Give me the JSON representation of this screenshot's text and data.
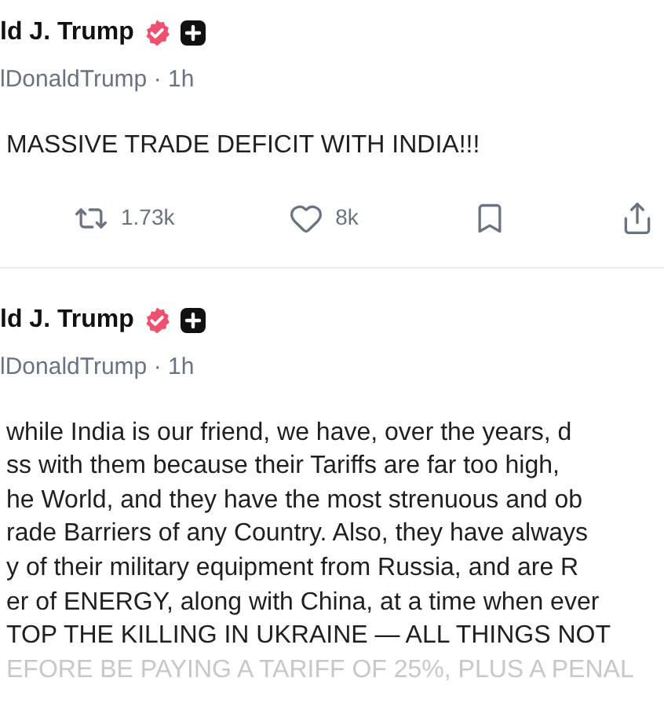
{
  "posts": [
    {
      "author": {
        "name": "ld J. Trump",
        "verified": true,
        "handle": "lDonaldTrump",
        "separator": "·",
        "time": "1h"
      },
      "lines": [
        {
          "text": "MASSIVE TRADE DEFICIT WITH INDIA!!!",
          "faded": false
        }
      ],
      "actions": [
        {
          "kind": "repost",
          "count": "1.73k"
        },
        {
          "kind": "like",
          "count": "8k"
        },
        {
          "kind": "bookmark"
        },
        {
          "kind": "share"
        }
      ]
    },
    {
      "author": {
        "name": "ld J. Trump",
        "verified": true,
        "handle": "lDonaldTrump",
        "separator": "·",
        "time": "1h"
      },
      "lines": [
        {
          "text": "while India is our friend, we have, over the years, d",
          "faded": false
        },
        {
          "text": "ss with them because their Tariffs are far too high,",
          "faded": false
        },
        {
          "text": "he World, and they have the most strenuous and ob",
          "faded": false
        },
        {
          "text": "rade Barriers of any Country. Also, they have always",
          "faded": false
        },
        {
          "text": "y of their military equipment from Russia, and are R",
          "faded": false
        },
        {
          "text": "er of ENERGY, along with China, at a time when ever",
          "faded": false
        },
        {
          "text": "TOP THE KILLING IN UKRAINE — ALL THINGS NOT",
          "faded": false
        },
        {
          "text": "EFORE BE PAYING A TARIFF OF 25%, PLUS A PENAL",
          "faded": true
        }
      ]
    }
  ]
}
